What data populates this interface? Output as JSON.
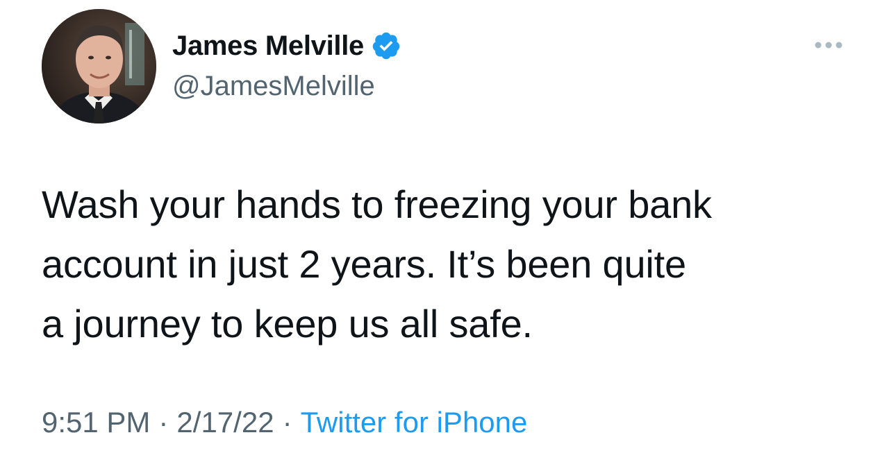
{
  "author": {
    "display_name": "James Melville",
    "handle": "@JamesMelville",
    "verified": true
  },
  "tweet": {
    "text": "Wash your hands to freezing your bank\naccount in just 2 years. It’s been quite\na journey to keep us all safe."
  },
  "meta": {
    "time": "9:51 PM",
    "separator": "·",
    "date": "2/17/22",
    "source": "Twitter for iPhone"
  },
  "icons": {
    "verified": "verified-badge-icon",
    "more": "more-options-icon"
  },
  "colors": {
    "text": "#0f1419",
    "secondary": "#536471",
    "accent": "#1d9bf0"
  }
}
